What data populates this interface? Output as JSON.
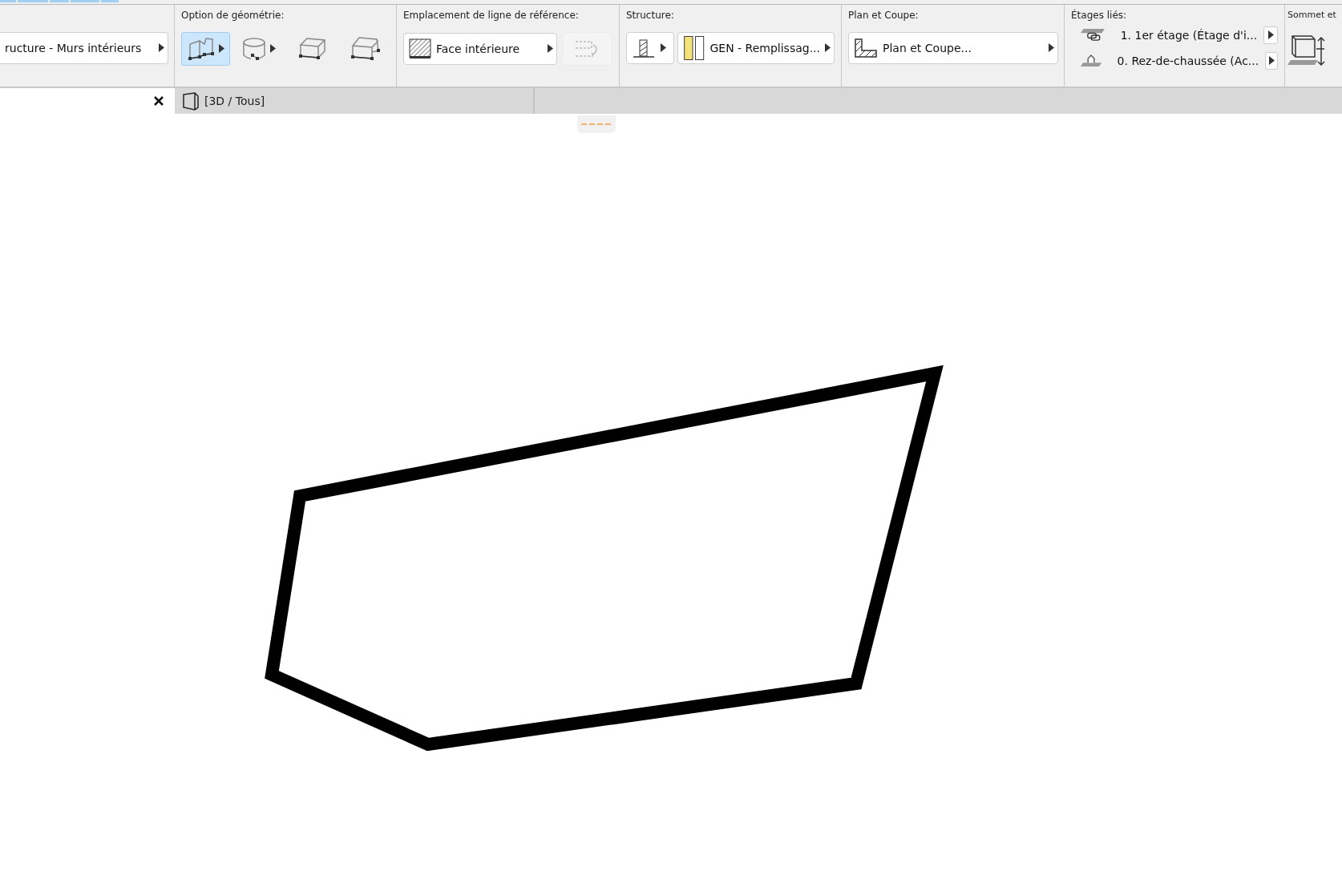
{
  "toolbar": {
    "layer": {
      "value": "ructure - Murs intérieurs"
    },
    "geometry": {
      "label": "Option de géométrie:",
      "options": [
        {
          "kind": "straight",
          "selected": true,
          "menu": true
        },
        {
          "kind": "curved",
          "selected": false,
          "menu": true
        },
        {
          "kind": "box",
          "selected": false,
          "menu": false
        },
        {
          "kind": "polygon",
          "selected": false,
          "menu": false
        }
      ]
    },
    "reference_line": {
      "label": "Emplacement de ligne de référence:",
      "value": "Face intérieure",
      "flip_disabled": true
    },
    "structure": {
      "label": "Structure:",
      "value": "GEN - Remplissag..."
    },
    "plan_section": {
      "label": "Plan et Coupe:",
      "value": "Plan et Coupe..."
    },
    "linked_stories": {
      "label": "Étages liés:",
      "stories": [
        {
          "kind": "top",
          "value": "1. 1er étage (Étage d'i..."
        },
        {
          "kind": "home",
          "value": "0. Rez-de-chaussée (Ac..."
        }
      ]
    },
    "top_bottom": {
      "label": "Sommet et"
    }
  },
  "tab_bar": {
    "tabs": [
      {
        "label": "[3D / Tous]",
        "selected": true
      }
    ]
  }
}
